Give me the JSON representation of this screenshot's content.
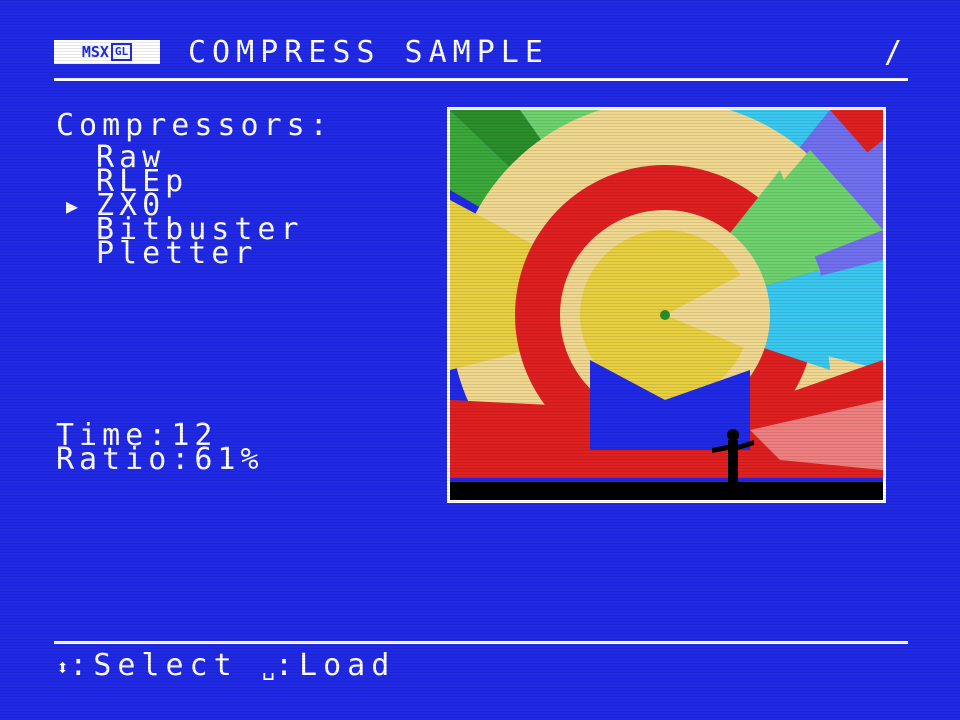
{
  "header": {
    "logo_text": "MSX",
    "logo_badge": "GL",
    "title": "COMPRESS SAMPLE",
    "indicator": "/"
  },
  "compressors": {
    "heading": "Compressors:",
    "selected_index": 2,
    "items": [
      {
        "label": "Raw"
      },
      {
        "label": "RLEp"
      },
      {
        "label": "ZX0"
      },
      {
        "label": "Bitbuster"
      },
      {
        "label": "Pletter"
      }
    ]
  },
  "stats": {
    "time_label": "Time:",
    "time_value": "12",
    "ratio_label": "Ratio:",
    "ratio_value": "61%"
  },
  "footer": {
    "select_icon": "up-down-arrows-icon",
    "select_label": ":Select",
    "load_icon": "space-key-icon",
    "load_label": ":Load"
  },
  "colors": {
    "background": "#1f29e6",
    "foreground": "#ffffff"
  }
}
